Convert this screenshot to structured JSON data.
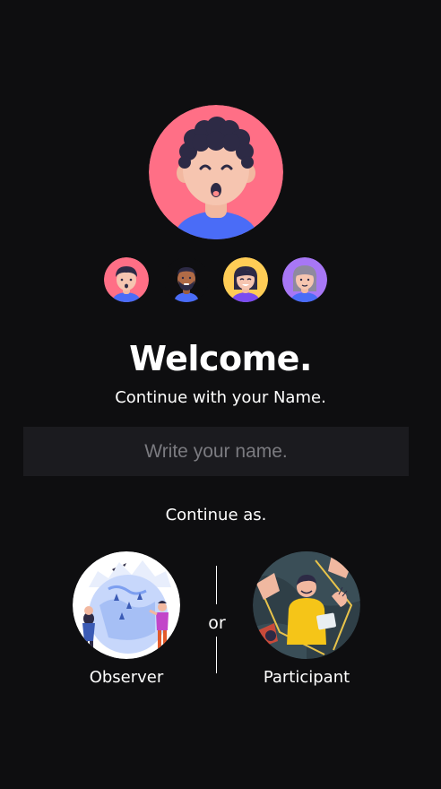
{
  "main_avatar": {
    "icon": "curly-hair-boy-avatar-icon",
    "bg_color": "#ff6f86"
  },
  "avatar_options": [
    {
      "icon": "boy-avatar-icon",
      "bg_color": "#ff6f86"
    },
    {
      "icon": "bearded-man-avatar-icon",
      "bg_color": "#0e0e10"
    },
    {
      "icon": "girl-avatar-icon",
      "bg_color": "#ffcd56"
    },
    {
      "icon": "grey-hair-woman-avatar-icon",
      "bg_color": "#a777f5"
    }
  ],
  "welcome": {
    "title": "Welcome.",
    "subtitle": "Continue with your Name."
  },
  "name_field": {
    "placeholder": "Write your name.",
    "value": ""
  },
  "continue_as": "Continue as.",
  "roles": {
    "observer": {
      "label": "Observer",
      "icon": "observer-globe-illustration"
    },
    "separator": "or",
    "participant": {
      "label": "Participant",
      "icon": "participant-illustration"
    }
  }
}
